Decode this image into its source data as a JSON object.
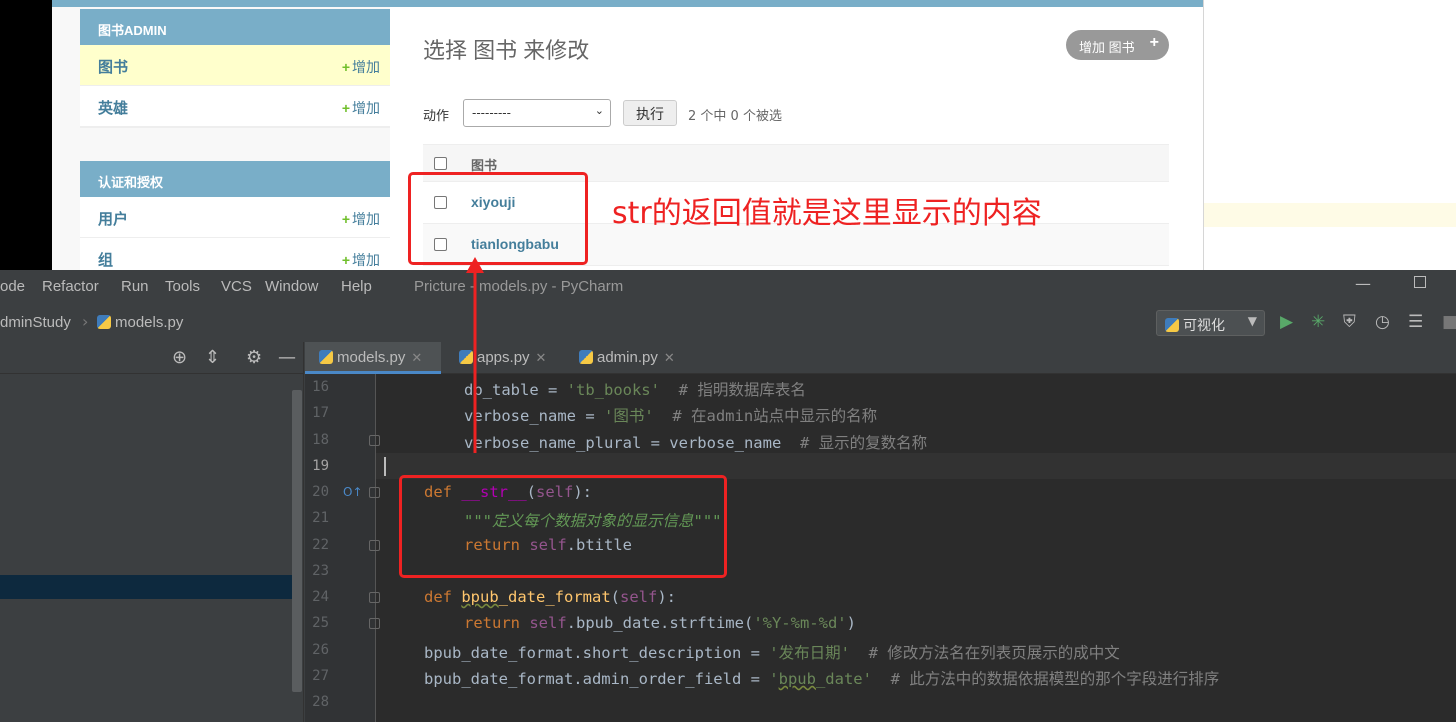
{
  "admin": {
    "apps": [
      {
        "caption": "图书ADMIN",
        "models": [
          {
            "name": "图书",
            "add": "增加"
          },
          {
            "name": "英雄",
            "add": "增加"
          }
        ]
      },
      {
        "caption": "认证和授权",
        "models": [
          {
            "name": "用户",
            "add": "增加"
          },
          {
            "name": "组",
            "add": "增加"
          }
        ]
      }
    ],
    "title": "选择 图书 来修改",
    "add_button": "增加 图书",
    "action_label": "动作",
    "action_select_value": "---------",
    "go_button": "执行",
    "counter": "2 个中 0 个被选",
    "column_header": "图书",
    "rows": [
      "xiyouji",
      "tianlongbabu"
    ]
  },
  "annotation": "str的返回值就是这里显示的内容",
  "ide": {
    "menu": [
      "ode",
      "Refactor",
      "Run",
      "Tools",
      "VCS",
      "Window",
      "Help"
    ],
    "window_title": "Pricture - models.py - PyCharm",
    "breadcrumb": [
      "dminStudy",
      "models.py"
    ],
    "run_config": "可视化",
    "tabs": [
      "models.py",
      "apps.py",
      "admin.py"
    ],
    "code_lines": [
      {
        "no": "16",
        "text": "        db_table = 'tb_books'  # 指明数据库表名"
      },
      {
        "no": "17",
        "text": "        verbose_name = '图书'  # 在admin站点中显示的名称"
      },
      {
        "no": "18",
        "text": "        verbose_name_plural = verbose_name  # 显示的复数名称"
      },
      {
        "no": "19",
        "text": ""
      },
      {
        "no": "20",
        "text": "    def __str__(self):"
      },
      {
        "no": "21",
        "text": "        \"\"\"定义每个数据对象的显示信息\"\"\""
      },
      {
        "no": "22",
        "text": "        return self.btitle"
      },
      {
        "no": "23",
        "text": ""
      },
      {
        "no": "24",
        "text": "    def bpub_date_format(self):"
      },
      {
        "no": "25",
        "text": "        return self.bpub_date.strftime('%Y-%m-%d')"
      },
      {
        "no": "26",
        "text": "    bpub_date_format.short_description = '发布日期'  # 修改方法名在列表页展示的成中文"
      },
      {
        "no": "27",
        "text": "    bpub_date_format.admin_order_field = 'bpub_date'  # 此方法中的数据依据模型的那个字段进行排序"
      },
      {
        "no": "28",
        "text": ""
      }
    ]
  }
}
